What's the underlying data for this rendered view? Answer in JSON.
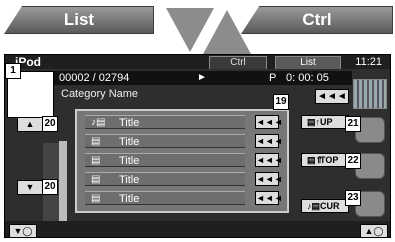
{
  "top_tabs": {
    "list_label": "List",
    "ctrl_label": "Ctrl"
  },
  "screen": {
    "app_title": "iPod",
    "tabs": {
      "ctrl": "Ctrl",
      "list": "List"
    },
    "clock": "11:21",
    "track_counter": "00002 / 02794",
    "play_symbol": "►",
    "p_flag": "P",
    "play_time": "0: 00: 05",
    "category": "Category Name",
    "back_symbol": "◄◄◄"
  },
  "list": {
    "rows": [
      {
        "icon": "♪▤",
        "title": "Title",
        "button": "◄◄◄"
      },
      {
        "icon": "▤",
        "title": "Title",
        "button": "◄◄◄"
      },
      {
        "icon": "▤",
        "title": "Title",
        "button": "◄◄◄"
      },
      {
        "icon": "▤",
        "title": "Title",
        "button": "◄◄◄"
      },
      {
        "icon": "▤",
        "title": "Title",
        "button": "◄◄◄"
      }
    ]
  },
  "nav_buttons": {
    "up": {
      "icon": "▤↑",
      "label": "UP"
    },
    "top": {
      "icon": "▤⇑",
      "label": "TOP"
    },
    "cur": {
      "icon": "♪▤",
      "label": "CUR"
    }
  },
  "scroll": {
    "up_symbol": "▲",
    "down_symbol": "▼"
  },
  "bottom": {
    "left_symbol": "▼◯",
    "right_symbol": "▲◯"
  },
  "callouts": [
    "1",
    "19",
    "20",
    "20",
    "21",
    "22",
    "23"
  ]
}
